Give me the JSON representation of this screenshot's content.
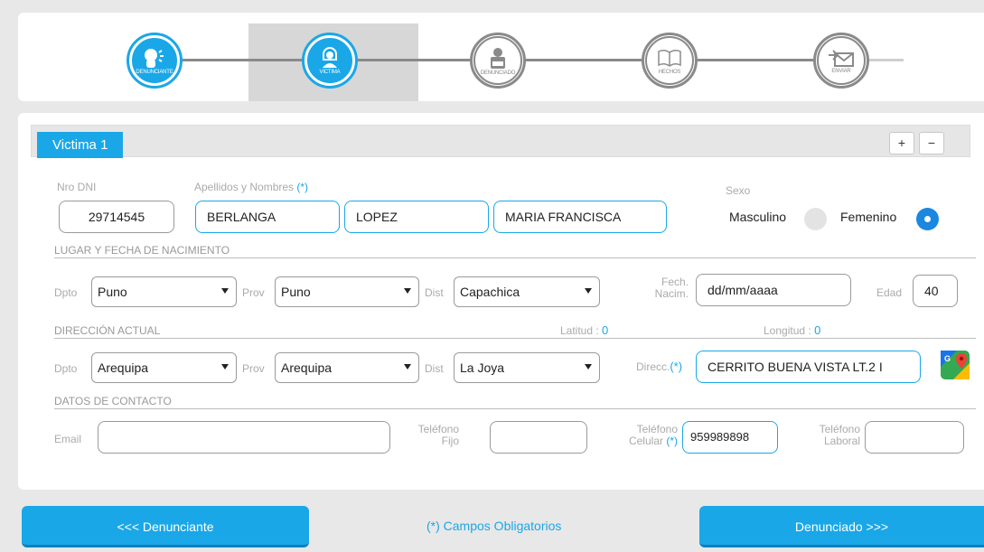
{
  "stepper": {
    "steps": [
      {
        "label": "DENUNCIANTE",
        "icon": "speaking-person-icon",
        "state": "active"
      },
      {
        "label": "VICTIMA",
        "icon": "woman-icon",
        "state": "active-current"
      },
      {
        "label": "DENUNCIADO",
        "icon": "suspect-icon",
        "state": "inactive"
      },
      {
        "label": "HECHOS",
        "icon": "book-icon",
        "state": "inactive"
      },
      {
        "label": "ENVIAR",
        "icon": "send-mail-icon",
        "state": "inactive"
      }
    ]
  },
  "tab": {
    "label": "Victima 1",
    "add_label": "+",
    "remove_label": "−"
  },
  "person": {
    "dni_label": "Nro DNI",
    "dni_value": "29714545",
    "names_label": "Apellidos y Nombres",
    "names_required": "(*)",
    "apellido_paterno": "BERLANGA",
    "apellido_materno": "LOPEZ",
    "nombres": "MARIA FRANCISCA",
    "sexo_label": "Sexo",
    "masculino_label": "Masculino",
    "femenino_label": "Femenino",
    "selected_sexo": "Femenino"
  },
  "nacimiento": {
    "section_title": "LUGAR Y FECHA DE NACIMIENTO",
    "dpto_label": "Dpto",
    "dpto_value": "Puno",
    "prov_label": "Prov",
    "prov_value": "Puno",
    "dist_label": "Dist",
    "dist_value": "Capachica",
    "fecha_label_1": "Fech.",
    "fecha_label_2": "Nacim.",
    "fecha_value": "dd/mm/aaaa",
    "edad_label": "Edad",
    "edad_value": "40"
  },
  "direccion": {
    "section_title": "DIRECCIÓN ACTUAL",
    "latitud_label": "Latitud :",
    "latitud_value": "0",
    "longitud_label": "Longitud :",
    "longitud_value": "0",
    "dpto_label": "Dpto",
    "dpto_value": "Arequipa",
    "prov_label": "Prov",
    "prov_value": "Arequipa",
    "dist_label": "Dist",
    "dist_value": "La Joya",
    "direcc_label": "Direcc.",
    "direcc_required": "(*)",
    "direcc_value": "CERRITO BUENA VISTA LT.2 I"
  },
  "contacto": {
    "section_title": "DATOS DE CONTACTO",
    "email_label": "Email",
    "email_value": "",
    "tel_fijo_label_1": "Teléfono",
    "tel_fijo_label_2": "Fijo",
    "tel_fijo_value": "",
    "tel_cel_label_1": "Teléfono",
    "tel_cel_label_2": "Celular",
    "tel_cel_required": "(*)",
    "tel_cel_value": "959989898",
    "tel_lab_label_1": "Teléfono",
    "tel_lab_label_2": "Laboral",
    "tel_lab_value": ""
  },
  "footer": {
    "prev_label": "<<< Denunciante",
    "note": "(*) Campos Obligatorios",
    "next_label": "Denunciado >>>"
  },
  "colors": {
    "accent": "#1aa7e8",
    "inactive": "#8a8a8a"
  }
}
